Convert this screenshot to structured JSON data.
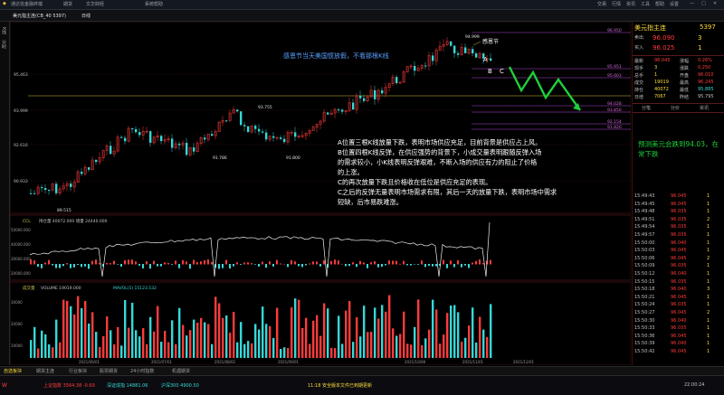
{
  "titlebar": {
    "app_title": "通达信金融终端",
    "items": [
      "期货",
      "文华财经",
      "系统帮助"
    ],
    "right_menu": [
      "交易",
      "行情",
      "资讯",
      "工具",
      "帮助",
      "设置"
    ]
  },
  "toolbar": {
    "period": "日线",
    "symbol_label": "美元指主连(CB_40 5397)"
  },
  "chart": {
    "annotation_top": "感恩节当天美国惯放假，不看那根K线",
    "annotation_thanks": "感恩节",
    "marks": {
      "A": "A",
      "B": "B",
      "C": "C"
    },
    "price_levels": [
      "95.463",
      "93.999",
      "92.616",
      "90.933"
    ],
    "peak_labels": {
      "hi1": "94.999",
      "lo1": "91.786",
      "mid1": "93.755",
      "lo2": "91.800",
      "low": "89.515"
    },
    "right_levels": [
      "96.950",
      "95.951",
      "95.603",
      "94.028",
      "93.850",
      "92.154",
      "91.820"
    ],
    "analysis_lines": [
      "A位置三根K线放量下跌，表明市场供应充足，目前背景是供应占上风。",
      "B位置四根K线反弹，在供应强势的背景下，小成交量表明跟随反弹入场",
      "的需求较小，小K线表明反弹艰难，不断入场的供应有力的阻止了价格",
      "的上涨。",
      "C的再次放量下跌且价格收在低位是供应充足的表现。",
      "C之后的反弹无量表明市场需求有限，其后一天的放量下跌，表明市场中需求",
      "短缺，后市易跌难涨。"
    ],
    "vol_indicator_label": "CCL",
    "vol_indicator_values": "持仓量  40072.000   增量 24440.000",
    "volume_label": "成交量",
    "volume_value": "VOLUME 19019.000",
    "volume_ma": "MAVOL(5) 15123.532",
    "osc_axis": [
      "50000.000",
      "40000.000",
      "30000.000",
      "20000.000"
    ],
    "vol_axis": [
      "30000",
      "20000",
      "10000"
    ],
    "dates": [
      "2021/06/01",
      "2021/07/01",
      "2021/08/02",
      "2021/09/01",
      "2021/10/08",
      "2021/11/01",
      "2021/12/01"
    ]
  },
  "quote": {
    "name": "美元指主连",
    "code": "5397",
    "sell_label": "卖出",
    "sell_price": "96.090",
    "sell_qty": "3",
    "buy_label": "买入",
    "buy_price": "96.025",
    "buy_qty": "1",
    "rows": [
      {
        "k1": "最新",
        "v1": "96.045",
        "k2": "涨幅",
        "v2": "0.26%"
      },
      {
        "k1": "现手",
        "v1": "3",
        "k2": "涨跌",
        "v2": "0.250"
      },
      {
        "k1": "总手",
        "v1": "1",
        "k2": "开盘",
        "v2": "96.010"
      },
      {
        "k1": "成交",
        "v1": "19019",
        "k2": "最高",
        "v2": "96.245"
      },
      {
        "k1": "持仓",
        "v1": "40072",
        "k2": "最低",
        "v2": "95.885"
      },
      {
        "k1": "日增",
        "v1": "7067",
        "k2": "昨结",
        "v2": "95.795"
      }
    ],
    "tabs": [
      "分笔",
      "分价",
      "资讯"
    ],
    "note": "预测美元会跌到94.03，在常下跌",
    "tick_times": [
      "15:49:43",
      "15:49:45",
      "15:49:48",
      "15:49:51",
      "15:49:54",
      "15:49:57",
      "15:50:00",
      "15:50:03",
      "15:50:06",
      "15:50:09",
      "15:50:12",
      "15:50:15",
      "15:50:18",
      "15:50:21",
      "15:50:24",
      "15:50:27",
      "15:50:30",
      "15:50:33",
      "15:50:36",
      "15:50:39",
      "15:50:42"
    ],
    "tick_prices": [
      "96.045",
      "96.045",
      "96.035",
      "96.035",
      "96.035",
      "96.035",
      "96.040",
      "96.045",
      "96.045",
      "96.035",
      "96.040",
      "96.035",
      "96.040",
      "96.045",
      "96.035",
      "96.045",
      "96.040",
      "96.035",
      "96.045",
      "96.040",
      "96.045"
    ],
    "tick_qty": [
      "1",
      "1",
      "1",
      "2",
      "1",
      "1",
      "1",
      "1",
      "2",
      "1",
      "1",
      "1",
      "3",
      "1",
      "1",
      "2",
      "1",
      "1",
      "1",
      "1",
      "1"
    ]
  },
  "bottom_tabs": [
    "自选板块",
    "期货主连",
    "行业板块",
    "股票期货",
    "24小时指数",
    "机遇期货"
  ],
  "status": {
    "left": "上证指数 3564.38  -0.69",
    "mid1": "深证成指 14881.06",
    "mid2": "沪深300 4900.50",
    "center": "11:18 安全版本文件已到期更新",
    "time": "22:00:24"
  },
  "colors": {
    "up": "#ff3b3b",
    "down": "#36d8d8",
    "annot": "#5aa0ff",
    "text_note": "#ffffff",
    "accent": "#ffdf3a"
  }
}
